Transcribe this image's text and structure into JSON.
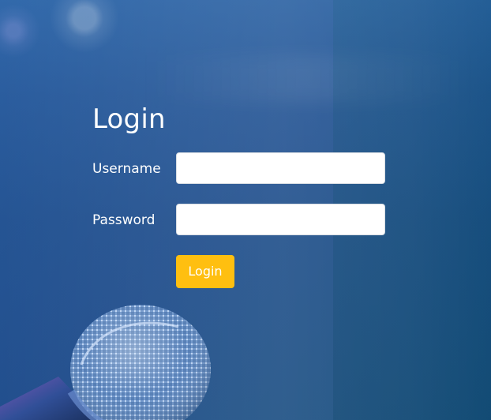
{
  "form": {
    "title": "Login",
    "username_label": "Username",
    "username_value": "",
    "password_label": "Password",
    "password_value": "",
    "submit_label": "Login"
  },
  "theme": {
    "primary_overlay": "#1f4f86",
    "button_color": "#ffbf10",
    "text_color": "#ffffff"
  },
  "background": {
    "image": "microphone-stage-photo"
  }
}
